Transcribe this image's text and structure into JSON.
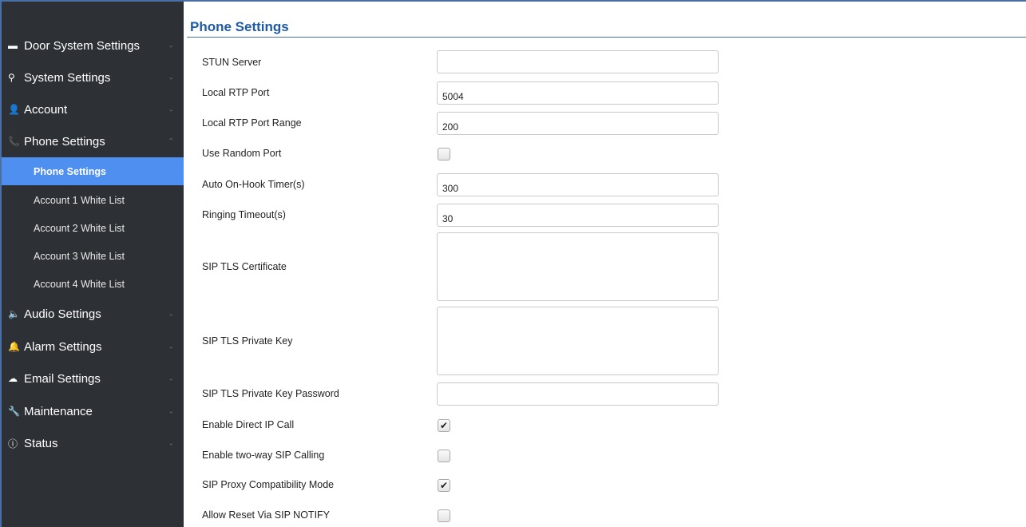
{
  "sidebar": {
    "menu": [
      {
        "label": "Door System Settings",
        "icon": "door-icon",
        "glyph": "▬"
      },
      {
        "label": "System Settings",
        "icon": "key-icon",
        "glyph": "⚲"
      },
      {
        "label": "Account",
        "icon": "user-icon",
        "glyph": "👤"
      },
      {
        "label": "Phone Settings",
        "icon": "phone-icon",
        "glyph": "📞"
      },
      {
        "label": "Audio Settings",
        "icon": "speaker-icon",
        "glyph": "🔈"
      },
      {
        "label": "Alarm Settings",
        "icon": "bell-icon",
        "glyph": "🔔"
      },
      {
        "label": "Email Settings",
        "icon": "cloud-icon",
        "glyph": "☁"
      },
      {
        "label": "Maintenance",
        "icon": "wrench-icon",
        "glyph": "🔧"
      },
      {
        "label": "Status",
        "icon": "info-icon",
        "glyph": "ⓘ"
      }
    ],
    "submenu": [
      {
        "label": "Phone Settings",
        "active": true
      },
      {
        "label": "Account 1 White List"
      },
      {
        "label": "Account 2 White List"
      },
      {
        "label": "Account 3 White List"
      },
      {
        "label": "Account 4 White List"
      }
    ],
    "chevron_down": "⌄",
    "chevron_up": "⌃"
  },
  "page": {
    "title": "Phone Settings"
  },
  "form": {
    "stun_server": {
      "label": "STUN Server",
      "value": ""
    },
    "local_rtp_port": {
      "label": "Local RTP Port",
      "value": "5004"
    },
    "local_rtp_port_range": {
      "label": "Local RTP Port Range",
      "value": "200"
    },
    "use_random_port": {
      "label": "Use Random Port",
      "checked": false
    },
    "auto_on_hook_timer": {
      "label": "Auto On-Hook Timer(s)",
      "value": "300"
    },
    "ringing_timeout": {
      "label": "Ringing Timeout(s)",
      "value": "30"
    },
    "sip_tls_certificate": {
      "label": "SIP TLS Certificate",
      "value": ""
    },
    "sip_tls_private_key": {
      "label": "SIP TLS Private Key",
      "value": ""
    },
    "sip_tls_private_key_password": {
      "label": "SIP TLS Private Key Password",
      "value": ""
    },
    "enable_direct_ip_call": {
      "label": "Enable Direct IP Call",
      "checked": true
    },
    "enable_two_way_sip_calling": {
      "label": "Enable two-way SIP Calling",
      "checked": false
    },
    "sip_proxy_compatibility_mode": {
      "label": "SIP Proxy Compatibility Mode",
      "checked": true
    },
    "allow_reset_via_sip_notify": {
      "label": "Allow Reset Via SIP NOTIFY",
      "checked": false
    }
  },
  "check_glyph": "✔",
  "colors": {
    "sidebar_bg": "#2d3136",
    "active_item": "#4f8ff0",
    "title": "#1e5aa6"
  }
}
